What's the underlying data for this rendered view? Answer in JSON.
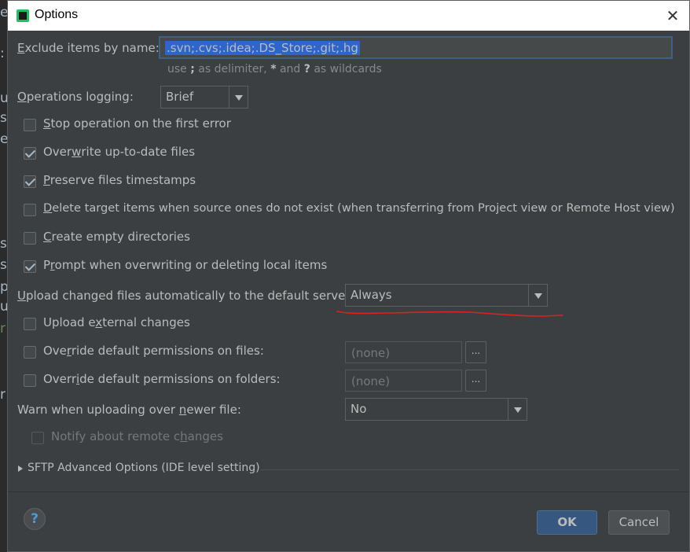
{
  "window": {
    "title": "Options",
    "close_symbol": "✕"
  },
  "exclude": {
    "label_pre": "",
    "label_ul": "E",
    "label_post": "xclude items by name:",
    "value": ".svn;.cvs;.idea;.DS_Store;.git;.hg",
    "hint_parts": [
      "use ",
      ";",
      " as delimiter, ",
      "*",
      " and ",
      "?",
      " as wildcards"
    ]
  },
  "ops_logging": {
    "label_pre": "",
    "label_ul": "O",
    "label_post": "perations logging:",
    "value": "Brief"
  },
  "checkboxes": [
    {
      "pre": "",
      "ul": "S",
      "post": "top operation on the first error",
      "checked": false
    },
    {
      "pre": "Over",
      "ul": "w",
      "post": "rite up-to-date files",
      "checked": true
    },
    {
      "pre": "",
      "ul": "P",
      "post": "reserve files timestamps",
      "checked": true
    },
    {
      "pre": "",
      "ul": "D",
      "post": "elete target items when source ones do not exist (when transferring from Project view or Remote Host view)",
      "checked": false
    },
    {
      "pre": "",
      "ul": "C",
      "post": "reate empty directories",
      "checked": false
    },
    {
      "pre": "P",
      "ul": "r",
      "post": "ompt when overwriting or deleting local items",
      "checked": true
    }
  ],
  "upload_auto": {
    "label_pre": "",
    "label_ul": "U",
    "label_post": "pload changed files automatically to the default server",
    "value": "Always"
  },
  "upload_external": {
    "pre": "Upload e",
    "ul": "x",
    "post": "ternal changes",
    "checked": false
  },
  "override_files": {
    "pre": "Ove",
    "ul": "r",
    "post": "ride default permissions on files:",
    "checked": false,
    "value": "(none)",
    "button": "..."
  },
  "override_folders": {
    "pre": "Overr",
    "ul": "i",
    "post": "de default permissions on folders:",
    "checked": false,
    "value": "(none)",
    "button": "..."
  },
  "warn_newer": {
    "label_pre": "Warn when uploading over ",
    "label_ul": "n",
    "label_post": "ewer file:",
    "value": "No"
  },
  "notify_remote": {
    "pre": "Notify about remote c",
    "ul": "h",
    "post": "anges",
    "checked": false
  },
  "sftp": {
    "label": "SFTP Advanced Options (IDE level setting)"
  },
  "footer": {
    "help_symbol": "?",
    "ok_label": "OK",
    "cancel_label": "Cancel"
  },
  "colors": {
    "dialog_bg": "#3c3f41",
    "selection": "#2f65ca",
    "annotation": "#e0201c",
    "ok_button": "#365880"
  },
  "background_editor": {
    "chars": [
      "e",
      ":",
      "u",
      "s",
      "e",
      "s",
      "s",
      "p",
      "u",
      "r",
      "r"
    ]
  }
}
